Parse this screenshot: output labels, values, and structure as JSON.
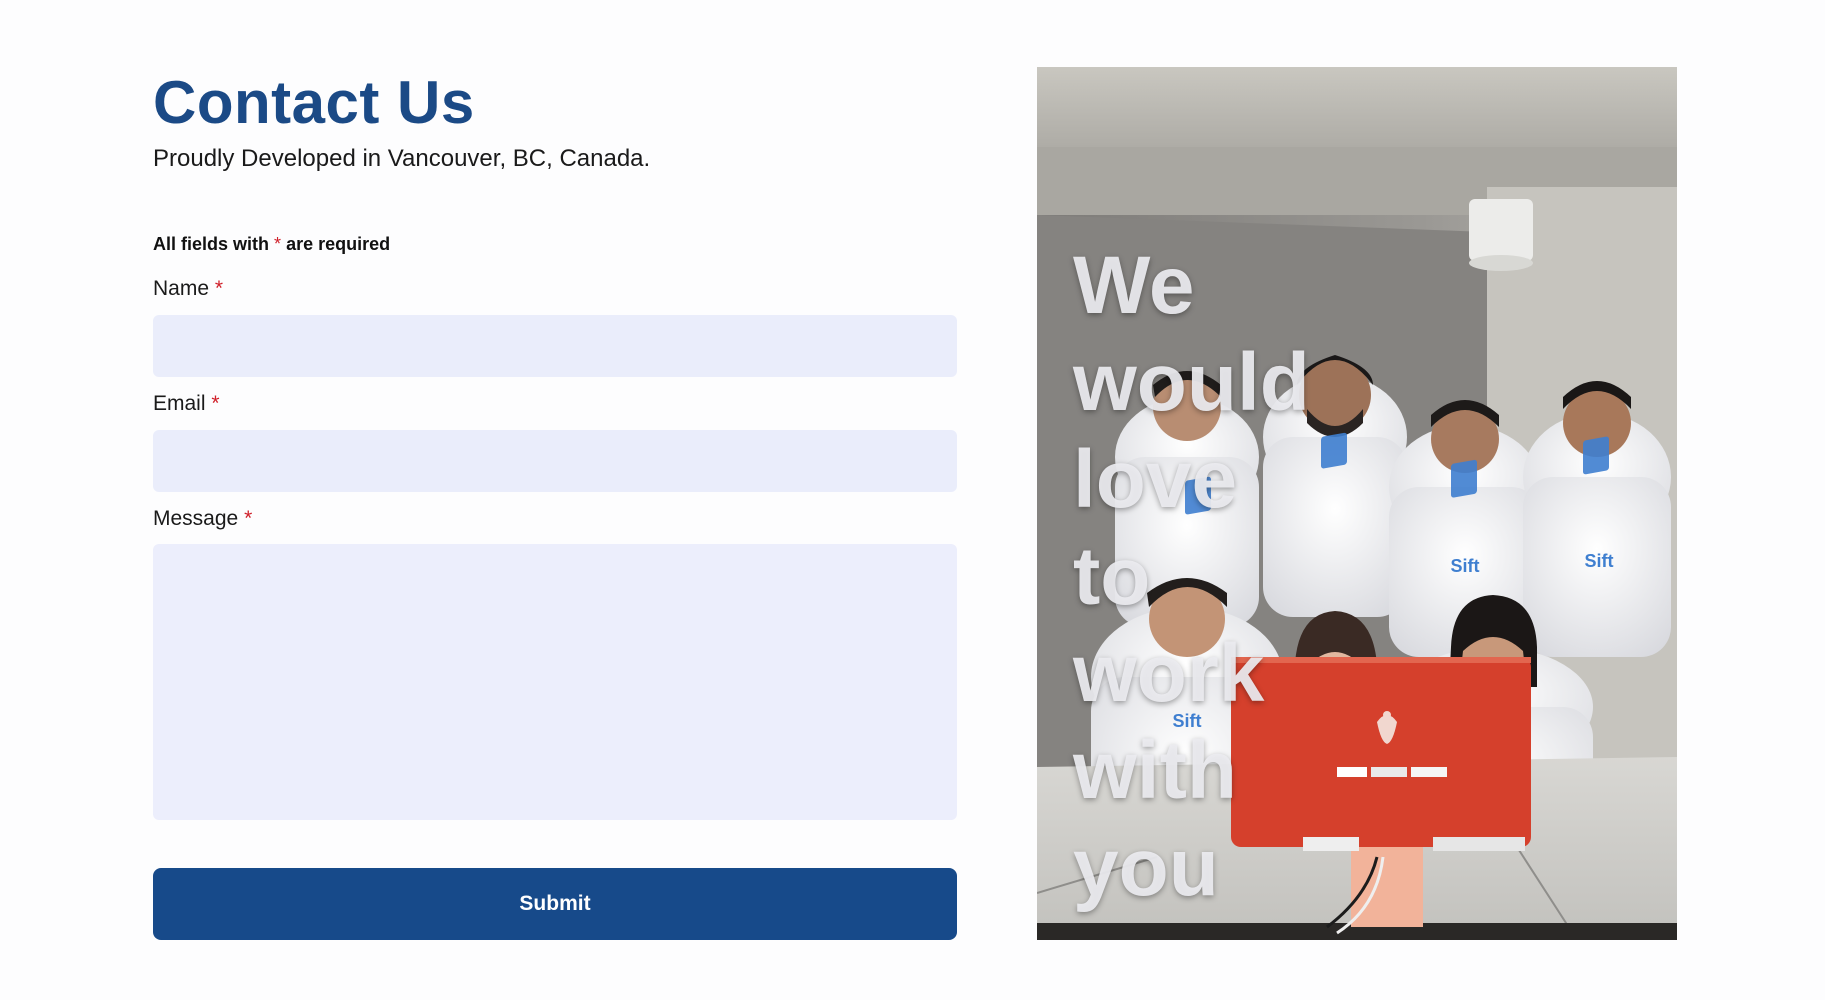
{
  "header": {
    "title": "Contact Us",
    "subtitle": "Proudly Developed in Vancouver, BC, Canada."
  },
  "form": {
    "required_note_prefix": "All fields with",
    "required_marker": "*",
    "required_note_suffix": "are required",
    "fields": [
      {
        "label": "Name",
        "value": "",
        "placeholder": ""
      },
      {
        "label": "Email",
        "value": "",
        "placeholder": ""
      },
      {
        "label": "Message",
        "value": "",
        "placeholder": ""
      }
    ],
    "submit_label": "Submit"
  },
  "photo": {
    "overlay_text": "We would love to work with you",
    "hoodie_logo_text": "Sift"
  },
  "colors": {
    "brand_blue": "#174a8a",
    "title_blue": "#1b4a86",
    "input_bg": "#eaedfb",
    "required_red": "#d0202a"
  }
}
